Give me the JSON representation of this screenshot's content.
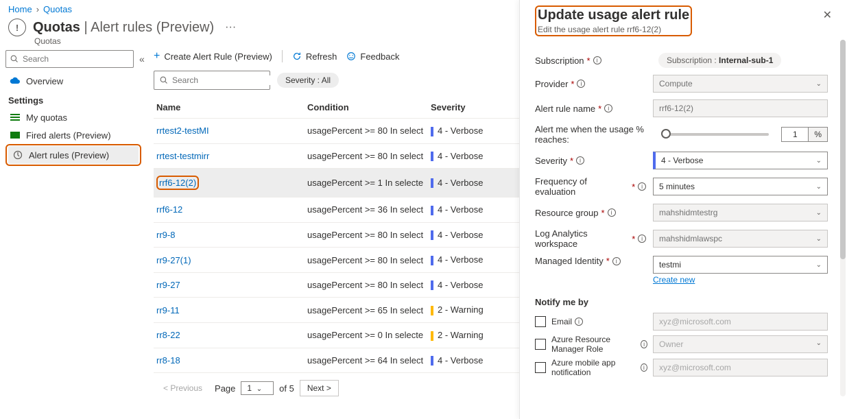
{
  "breadcrumb": {
    "home": "Home",
    "current": "Quotas"
  },
  "header": {
    "strong": "Quotas",
    "light": "Alert rules (Preview)",
    "sub": "Quotas"
  },
  "sidebar": {
    "search_placeholder": "Search",
    "overview": "Overview",
    "settings_label": "Settings",
    "items": [
      "My quotas",
      "Fired alerts (Preview)",
      "Alert rules (Preview)"
    ]
  },
  "toolbar": {
    "create": "Create Alert Rule (Preview)",
    "refresh": "Refresh",
    "feedback": "Feedback"
  },
  "filters": {
    "search_placeholder": "Search",
    "severity_pill": "Severity : All"
  },
  "table": {
    "headers": [
      "Name",
      "Condition",
      "Severity"
    ],
    "rows": [
      {
        "name": "rrtest2-testMI",
        "condition": "usagePercent >= 80 In select",
        "sev": "4 - Verbose",
        "sev_class": "verbose"
      },
      {
        "name": "rrtest-testmirr",
        "condition": "usagePercent >= 80 In select",
        "sev": "4 - Verbose",
        "sev_class": "verbose"
      },
      {
        "name": "rrf6-12(2)",
        "condition": "usagePercent >= 1 In selecte",
        "sev": "4 - Verbose",
        "sev_class": "verbose",
        "highlighted": true,
        "selected": true
      },
      {
        "name": "rrf6-12",
        "condition": "usagePercent >= 36 In select",
        "sev": "4 - Verbose",
        "sev_class": "verbose"
      },
      {
        "name": "rr9-8",
        "condition": "usagePercent >= 80 In select",
        "sev": "4 - Verbose",
        "sev_class": "verbose"
      },
      {
        "name": "rr9-27(1)",
        "condition": "usagePercent >= 80 In select",
        "sev": "4 - Verbose",
        "sev_class": "verbose"
      },
      {
        "name": "rr9-27",
        "condition": "usagePercent >= 80 In select",
        "sev": "4 - Verbose",
        "sev_class": "verbose"
      },
      {
        "name": "rr9-11",
        "condition": "usagePercent >= 65 In select",
        "sev": "2 - Warning",
        "sev_class": "warning"
      },
      {
        "name": "rr8-22",
        "condition": "usagePercent >= 0 In selecte",
        "sev": "2 - Warning",
        "sev_class": "warning"
      },
      {
        "name": "rr8-18",
        "condition": "usagePercent >= 64 In select",
        "sev": "4 - Verbose",
        "sev_class": "verbose"
      }
    ]
  },
  "pagination": {
    "prev": "< Previous",
    "page_label": "Page",
    "page": "1",
    "of_label": "of 5",
    "next": "Next >"
  },
  "panel": {
    "title": "Update usage alert rule",
    "sub": "Edit the usage alert rule rrf6-12(2)",
    "subscription_label": "Subscription",
    "subscription_value_prefix": "Subscription : ",
    "subscription_value_bold": "Internal-sub-1",
    "provider_label": "Provider",
    "provider_value": "Compute",
    "rulename_label": "Alert rule name",
    "rulename_value": "rrf6-12(2)",
    "alertme_label": "Alert me when the usage % reaches:",
    "alertme_value": "1",
    "alertme_unit": "%",
    "severity_label": "Severity",
    "severity_value": "4 - Verbose",
    "freq_label": "Frequency of evaluation",
    "freq_value": "5 minutes",
    "rg_label": "Resource group",
    "rg_value": "mahshidmtestrg",
    "law_label": "Log Analytics workspace",
    "law_value": "mahshidmlawspc",
    "mi_label": "Managed Identity",
    "mi_value": "testmi",
    "create_new": "Create new",
    "notify_title": "Notify me by",
    "notify_email": "Email",
    "notify_email_ph": "xyz@microsoft.com",
    "notify_arm": "Azure Resource Manager Role",
    "notify_arm_ph": "Owner",
    "notify_app": "Azure mobile app notification",
    "notify_app_ph": "xyz@microsoft.com"
  }
}
